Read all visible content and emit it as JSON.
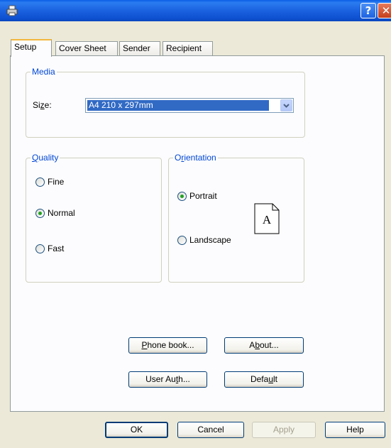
{
  "titlebar": {
    "help_symbol": "?",
    "close_symbol": "✕"
  },
  "tabs": [
    {
      "label": "Setup",
      "active": true
    },
    {
      "label": "Cover Sheet",
      "active": false
    },
    {
      "label": "Sender",
      "active": false
    },
    {
      "label": "Recipient",
      "active": false
    }
  ],
  "media": {
    "title": "Media",
    "size_label_pre": "Si",
    "size_label_ul": "z",
    "size_label_post": "e:",
    "size_value": "A4 210 x 297mm"
  },
  "quality": {
    "title_ul": "Q",
    "title_rest": "uality",
    "options": [
      {
        "label": "Fine",
        "checked": false
      },
      {
        "label": "Normal",
        "checked": true
      },
      {
        "label": "Fast",
        "checked": false
      }
    ]
  },
  "orientation": {
    "title_pre": "O",
    "title_ul": "r",
    "title_rest": "ientation",
    "options": [
      {
        "label": "Portrait",
        "checked": true
      },
      {
        "label": "Landscape",
        "checked": false
      }
    ],
    "paper_letter": "A"
  },
  "buttons": {
    "phonebook_ul": "P",
    "phonebook_rest": "hone book...",
    "about_pre": "A",
    "about_ul": "b",
    "about_rest": "out...",
    "userauth_pre": "User Au",
    "userauth_ul": "t",
    "userauth_rest": "h...",
    "default_pre": "Defa",
    "default_ul": "u",
    "default_rest": "lt"
  },
  "footer": {
    "ok": "OK",
    "cancel": "Cancel",
    "apply": "Apply",
    "help": "Help"
  },
  "colors": {
    "accent": "#0046d5",
    "selection": "#316ac5",
    "titlebar": "#0a5ee6",
    "radio_dot": "#21a121"
  }
}
